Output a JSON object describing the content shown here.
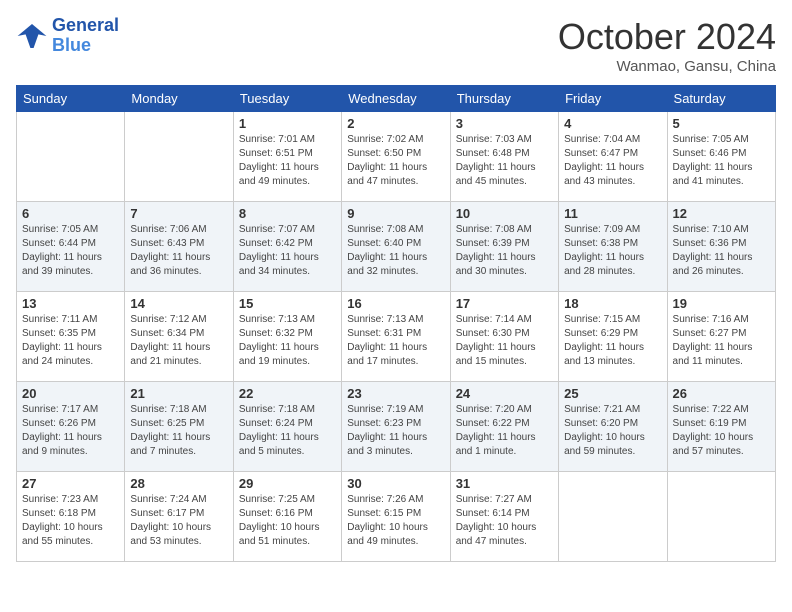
{
  "header": {
    "logo_line1": "General",
    "logo_line2": "Blue",
    "month": "October 2024",
    "location": "Wanmao, Gansu, China"
  },
  "weekdays": [
    "Sunday",
    "Monday",
    "Tuesday",
    "Wednesday",
    "Thursday",
    "Friday",
    "Saturday"
  ],
  "weeks": [
    [
      {
        "day": "",
        "info": ""
      },
      {
        "day": "",
        "info": ""
      },
      {
        "day": "1",
        "info": "Sunrise: 7:01 AM\nSunset: 6:51 PM\nDaylight: 11 hours and 49 minutes."
      },
      {
        "day": "2",
        "info": "Sunrise: 7:02 AM\nSunset: 6:50 PM\nDaylight: 11 hours and 47 minutes."
      },
      {
        "day": "3",
        "info": "Sunrise: 7:03 AM\nSunset: 6:48 PM\nDaylight: 11 hours and 45 minutes."
      },
      {
        "day": "4",
        "info": "Sunrise: 7:04 AM\nSunset: 6:47 PM\nDaylight: 11 hours and 43 minutes."
      },
      {
        "day": "5",
        "info": "Sunrise: 7:05 AM\nSunset: 6:46 PM\nDaylight: 11 hours and 41 minutes."
      }
    ],
    [
      {
        "day": "6",
        "info": "Sunrise: 7:05 AM\nSunset: 6:44 PM\nDaylight: 11 hours and 39 minutes."
      },
      {
        "day": "7",
        "info": "Sunrise: 7:06 AM\nSunset: 6:43 PM\nDaylight: 11 hours and 36 minutes."
      },
      {
        "day": "8",
        "info": "Sunrise: 7:07 AM\nSunset: 6:42 PM\nDaylight: 11 hours and 34 minutes."
      },
      {
        "day": "9",
        "info": "Sunrise: 7:08 AM\nSunset: 6:40 PM\nDaylight: 11 hours and 32 minutes."
      },
      {
        "day": "10",
        "info": "Sunrise: 7:08 AM\nSunset: 6:39 PM\nDaylight: 11 hours and 30 minutes."
      },
      {
        "day": "11",
        "info": "Sunrise: 7:09 AM\nSunset: 6:38 PM\nDaylight: 11 hours and 28 minutes."
      },
      {
        "day": "12",
        "info": "Sunrise: 7:10 AM\nSunset: 6:36 PM\nDaylight: 11 hours and 26 minutes."
      }
    ],
    [
      {
        "day": "13",
        "info": "Sunrise: 7:11 AM\nSunset: 6:35 PM\nDaylight: 11 hours and 24 minutes."
      },
      {
        "day": "14",
        "info": "Sunrise: 7:12 AM\nSunset: 6:34 PM\nDaylight: 11 hours and 21 minutes."
      },
      {
        "day": "15",
        "info": "Sunrise: 7:13 AM\nSunset: 6:32 PM\nDaylight: 11 hours and 19 minutes."
      },
      {
        "day": "16",
        "info": "Sunrise: 7:13 AM\nSunset: 6:31 PM\nDaylight: 11 hours and 17 minutes."
      },
      {
        "day": "17",
        "info": "Sunrise: 7:14 AM\nSunset: 6:30 PM\nDaylight: 11 hours and 15 minutes."
      },
      {
        "day": "18",
        "info": "Sunrise: 7:15 AM\nSunset: 6:29 PM\nDaylight: 11 hours and 13 minutes."
      },
      {
        "day": "19",
        "info": "Sunrise: 7:16 AM\nSunset: 6:27 PM\nDaylight: 11 hours and 11 minutes."
      }
    ],
    [
      {
        "day": "20",
        "info": "Sunrise: 7:17 AM\nSunset: 6:26 PM\nDaylight: 11 hours and 9 minutes."
      },
      {
        "day": "21",
        "info": "Sunrise: 7:18 AM\nSunset: 6:25 PM\nDaylight: 11 hours and 7 minutes."
      },
      {
        "day": "22",
        "info": "Sunrise: 7:18 AM\nSunset: 6:24 PM\nDaylight: 11 hours and 5 minutes."
      },
      {
        "day": "23",
        "info": "Sunrise: 7:19 AM\nSunset: 6:23 PM\nDaylight: 11 hours and 3 minutes."
      },
      {
        "day": "24",
        "info": "Sunrise: 7:20 AM\nSunset: 6:22 PM\nDaylight: 11 hours and 1 minute."
      },
      {
        "day": "25",
        "info": "Sunrise: 7:21 AM\nSunset: 6:20 PM\nDaylight: 10 hours and 59 minutes."
      },
      {
        "day": "26",
        "info": "Sunrise: 7:22 AM\nSunset: 6:19 PM\nDaylight: 10 hours and 57 minutes."
      }
    ],
    [
      {
        "day": "27",
        "info": "Sunrise: 7:23 AM\nSunset: 6:18 PM\nDaylight: 10 hours and 55 minutes."
      },
      {
        "day": "28",
        "info": "Sunrise: 7:24 AM\nSunset: 6:17 PM\nDaylight: 10 hours and 53 minutes."
      },
      {
        "day": "29",
        "info": "Sunrise: 7:25 AM\nSunset: 6:16 PM\nDaylight: 10 hours and 51 minutes."
      },
      {
        "day": "30",
        "info": "Sunrise: 7:26 AM\nSunset: 6:15 PM\nDaylight: 10 hours and 49 minutes."
      },
      {
        "day": "31",
        "info": "Sunrise: 7:27 AM\nSunset: 6:14 PM\nDaylight: 10 hours and 47 minutes."
      },
      {
        "day": "",
        "info": ""
      },
      {
        "day": "",
        "info": ""
      }
    ]
  ]
}
